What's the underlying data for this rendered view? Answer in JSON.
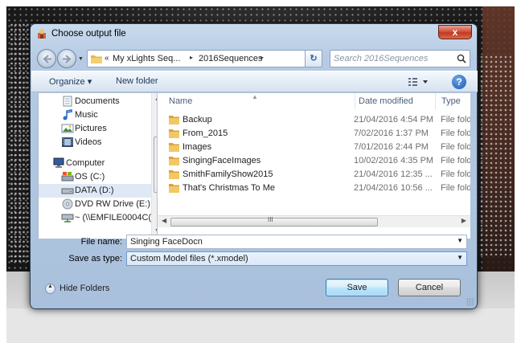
{
  "dialog": {
    "title": "Choose output file",
    "close_label": "x"
  },
  "address": {
    "chevrons": "«",
    "crumbs": [
      "My xLights Seq...",
      "2016Sequences"
    ],
    "separator": "▸",
    "search_placeholder": "Search 2016Sequences"
  },
  "toolbar": {
    "organize": "Organize ▾",
    "new_folder": "New folder",
    "views_icon": "views-icon",
    "help_icon": "help-icon",
    "help_label": "?"
  },
  "nav": {
    "items": [
      {
        "label": "Documents",
        "icon": "documents-icon"
      },
      {
        "label": "Music",
        "icon": "music-icon"
      },
      {
        "label": "Pictures",
        "icon": "pictures-icon"
      },
      {
        "label": "Videos",
        "icon": "videos-icon"
      },
      {
        "label": "Computer",
        "icon": "computer-icon"
      },
      {
        "label": "OS (C:)",
        "icon": "drive-icon"
      },
      {
        "label": "DATA (D:)",
        "icon": "drive-icon"
      },
      {
        "label": "DVD RW Drive (E:)",
        "icon": "dvd-icon"
      },
      {
        "label": "~ (\\\\EMFILE0004C(",
        "icon": "network-drive-icon"
      }
    ]
  },
  "files": {
    "columns": {
      "name": "Name",
      "date": "Date modified",
      "type": "Type"
    },
    "rows": [
      {
        "name": "Backup",
        "date": "21/04/2016 4:54 PM",
        "type": "File fold"
      },
      {
        "name": "From_2015",
        "date": "7/02/2016 1:37 PM",
        "type": "File fold"
      },
      {
        "name": "Images",
        "date": "7/01/2016 2:44 PM",
        "type": "File fold"
      },
      {
        "name": "SingingFaceImages",
        "date": "10/02/2016 4:35 PM",
        "type": "File fold"
      },
      {
        "name": "SmithFamilyShow2015",
        "date": "21/04/2016 12:35 ...",
        "type": "File fold"
      },
      {
        "name": "That's Christmas To Me",
        "date": "21/04/2016 10:56 ...",
        "type": "File fold"
      }
    ],
    "scroll_grip": "III"
  },
  "form": {
    "filename_label": "File name:",
    "filename_value": "Singing FaceDocn",
    "savetype_label": "Save as type:",
    "savetype_value": "Custom Model files (*.xmodel)"
  },
  "footer": {
    "hide_folders": "Hide Folders",
    "save": "Save",
    "cancel": "Cancel"
  },
  "colors": {
    "selection": "#dfe9f5",
    "folder": "#e8b64a",
    "accent": "#3c7fb1"
  }
}
